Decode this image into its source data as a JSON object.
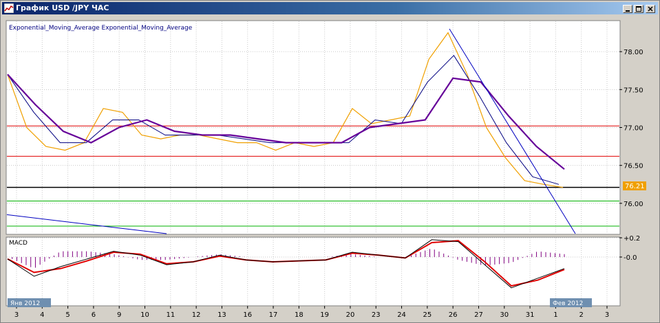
{
  "window": {
    "title": "График USD /JPY ЧАС"
  },
  "main_panel": {
    "indicator_label": "Exponential_Moving_Average Exponential_Moving_Average",
    "price_axis": [
      "78.00",
      "77.50",
      "77.00",
      "76.50",
      "76.00"
    ],
    "current_price": "76.21",
    "colors": {
      "price": "#f0a000",
      "ema_fast": "#000080",
      "ema_slow": "#660099",
      "resistance": "#e00000",
      "support": "#00b000",
      "current_line": "#000000",
      "trendline": "#0000c0"
    }
  },
  "macd_panel": {
    "label": "MACD",
    "axis": [
      "+0.2",
      "-0.0"
    ],
    "colors": {
      "macd": "#000000",
      "signal": "#e00000",
      "histogram": "#800080"
    }
  },
  "time_axis": {
    "ticks": [
      "3",
      "4",
      "5",
      "6",
      "9",
      "10",
      "11",
      "12",
      "13",
      "16",
      "17",
      "18",
      "19",
      "20",
      "23",
      "24",
      "25",
      "26",
      "27",
      "30",
      "31",
      "1",
      "2",
      "3"
    ],
    "start_badge": "Янв 2012",
    "end_badge": "Фев 2012"
  },
  "chart_data": {
    "type": "line",
    "title": "График USD /JPY ЧАС",
    "xlabel": "",
    "ylabel": "",
    "ylim": [
      75.6,
      78.4
    ],
    "x_categories": [
      "3",
      "4",
      "5",
      "6",
      "9",
      "10",
      "11",
      "12",
      "13",
      "16",
      "17",
      "18",
      "19",
      "20",
      "23",
      "24",
      "25",
      "26",
      "27",
      "30",
      "31",
      "1",
      "2",
      "3"
    ],
    "series": [
      {
        "name": "USD/JPY",
        "values": [
          77.7,
          77.0,
          76.75,
          76.7,
          76.8,
          77.25,
          77.2,
          76.9,
          76.85,
          76.9,
          76.9,
          76.85,
          76.8,
          76.8,
          76.7,
          76.8,
          76.75,
          76.8,
          77.25,
          77.05,
          77.1,
          77.15,
          77.9,
          78.25,
          77.7,
          77.0,
          76.6,
          76.3,
          76.25,
          76.21
        ]
      },
      {
        "name": "Exponential_Moving_Average",
        "values": [
          77.7,
          77.2,
          76.8,
          76.8,
          77.1,
          77.1,
          76.9,
          76.9,
          76.9,
          76.85,
          76.8,
          76.8,
          76.8,
          76.8,
          77.1,
          77.05,
          77.6,
          77.95,
          77.4,
          76.8,
          76.35,
          76.25
        ]
      },
      {
        "name": "Exponential_Moving_Average",
        "values": [
          77.7,
          77.3,
          76.95,
          76.8,
          77.0,
          77.1,
          76.95,
          76.9,
          76.9,
          76.85,
          76.8,
          76.8,
          76.8,
          77.0,
          77.05,
          77.1,
          77.65,
          77.6,
          77.15,
          76.75,
          76.45
        ]
      }
    ],
    "horizontal_levels": [
      77.02,
      76.62,
      76.21,
      76.03,
      75.7
    ],
    "macd": {
      "ylim": [
        -0.5,
        0.2
      ],
      "macd_line": [
        -0.02,
        -0.2,
        -0.1,
        -0.02,
        0.06,
        0.02,
        -0.08,
        -0.05,
        0.02,
        -0.03,
        -0.05,
        -0.04,
        -0.03,
        0.05,
        0.02,
        -0.01,
        0.18,
        0.16,
        -0.08,
        -0.32,
        -0.22,
        -0.12
      ],
      "signal_line": [
        -0.02,
        -0.16,
        -0.12,
        -0.04,
        0.05,
        0.03,
        -0.07,
        -0.05,
        0.01,
        -0.03,
        -0.05,
        -0.04,
        -0.03,
        0.04,
        0.02,
        -0.01,
        0.15,
        0.17,
        -0.05,
        -0.3,
        -0.24,
        -0.13
      ]
    }
  }
}
